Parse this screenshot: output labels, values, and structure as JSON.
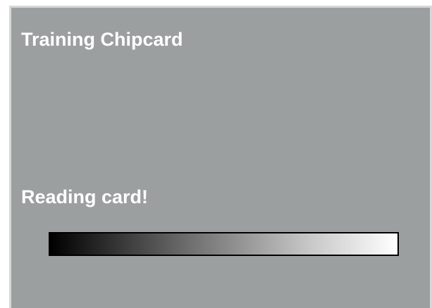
{
  "screen": {
    "title": "Training Chipcard",
    "status_message": "Reading card!"
  },
  "progress": {
    "value": 1.0,
    "style": "black-to-white gradient"
  },
  "colors": {
    "background": "#9c9fa0",
    "frame_border": "#d6d8d8",
    "text": "#ffffff",
    "progress_border": "#000000"
  }
}
